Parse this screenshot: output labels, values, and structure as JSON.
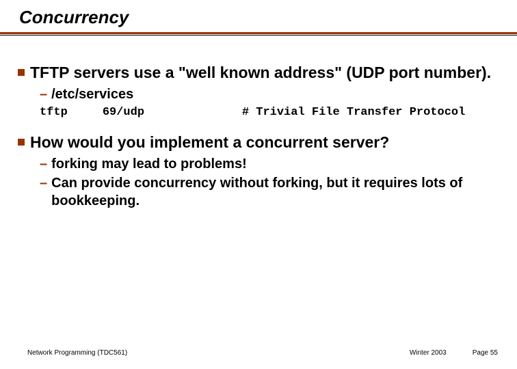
{
  "title": "Concurrency",
  "bullet1": "TFTP servers use a \"well known address\" (UDP port number).",
  "sub1": "/etc/services",
  "code": "tftp     69/udp              # Trivial File Transfer Protocol",
  "bullet2": "How would you implement a concurrent server?",
  "sub2a": "forking may lead to problems!",
  "sub2b": "Can provide concurrency without forking, but it requires lots of bookkeeping.",
  "footer_left": "Network Programming (TDC561)",
  "footer_mid": "Winter 2003",
  "footer_right": "Page 55"
}
